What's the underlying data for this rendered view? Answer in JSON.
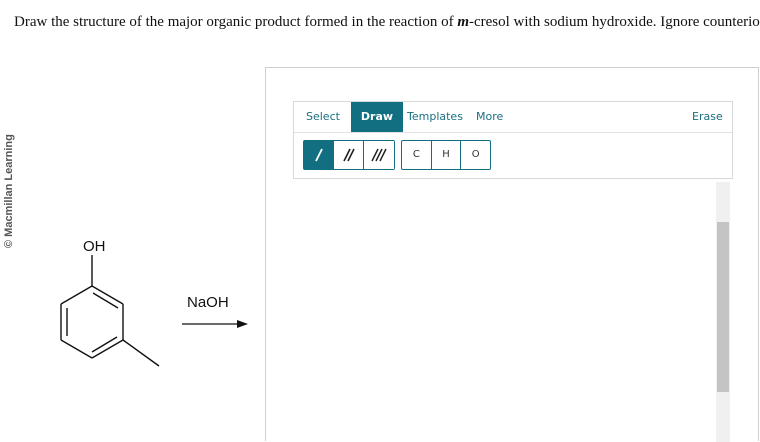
{
  "watermark": "© Macmillan Learning",
  "question": {
    "before": "Draw the structure of the major organic product formed in the reaction of ",
    "emphasis": "m",
    "after": "-cresol with sodium hydroxide. Ignore counterions."
  },
  "reaction": {
    "substituent_label": "OH",
    "reagent": "NaOH"
  },
  "toolbar": {
    "menu": [
      {
        "label": "Select",
        "active": false
      },
      {
        "label": "Draw",
        "active": true
      },
      {
        "label": "Templates",
        "active": false
      },
      {
        "label": "More",
        "active": false
      },
      {
        "label": "Erase",
        "active": false
      }
    ],
    "bonds": [
      "single-bond",
      "double-bond",
      "triple-bond"
    ],
    "active_bond": "single-bond",
    "atoms": [
      "C",
      "H",
      "O"
    ]
  },
  "colors": {
    "accent": "#126f81",
    "link": "#1a6f80"
  }
}
